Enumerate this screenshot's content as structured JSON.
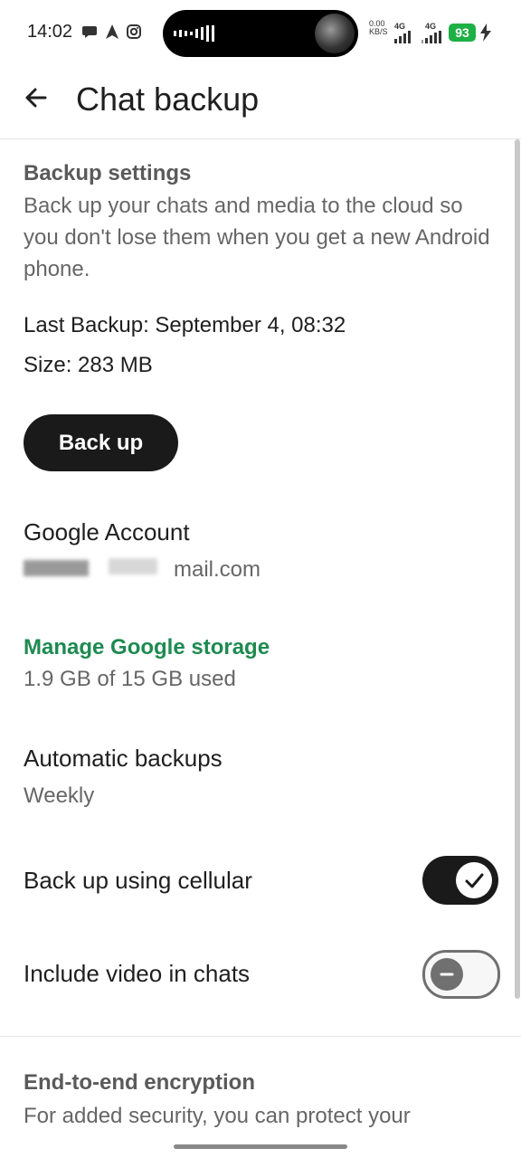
{
  "status_bar": {
    "time": "14:02",
    "net_speed_value": "0.00",
    "net_speed_unit": "KB/S",
    "network_1": "4G",
    "network_2": "4G",
    "battery": "93"
  },
  "app_bar": {
    "title": "Chat backup"
  },
  "backup_settings": {
    "title": "Backup settings",
    "description": "Back up your chats and media to the cloud so you don't lose them when you get a new Android phone.",
    "last_backup": "Last Backup: September 4, 08:32",
    "size": "Size: 283 MB",
    "button_label": "Back up"
  },
  "google_account": {
    "label": "Google Account",
    "email_visible_suffix": "mail.com"
  },
  "storage": {
    "link_label": "Manage Google storage",
    "usage": "1.9 GB of 15 GB used"
  },
  "automatic_backups": {
    "label": "Automatic backups",
    "value": "Weekly"
  },
  "cellular": {
    "label": "Back up using cellular",
    "enabled": true
  },
  "video": {
    "label": "Include video in chats",
    "enabled": false
  },
  "encryption": {
    "title": "End-to-end encryption",
    "description": "For added security, you can protect your"
  },
  "colors": {
    "accent_green": "#1e8a50",
    "battery_green": "#1db045",
    "toggle_dark": "#1a1a1a"
  }
}
